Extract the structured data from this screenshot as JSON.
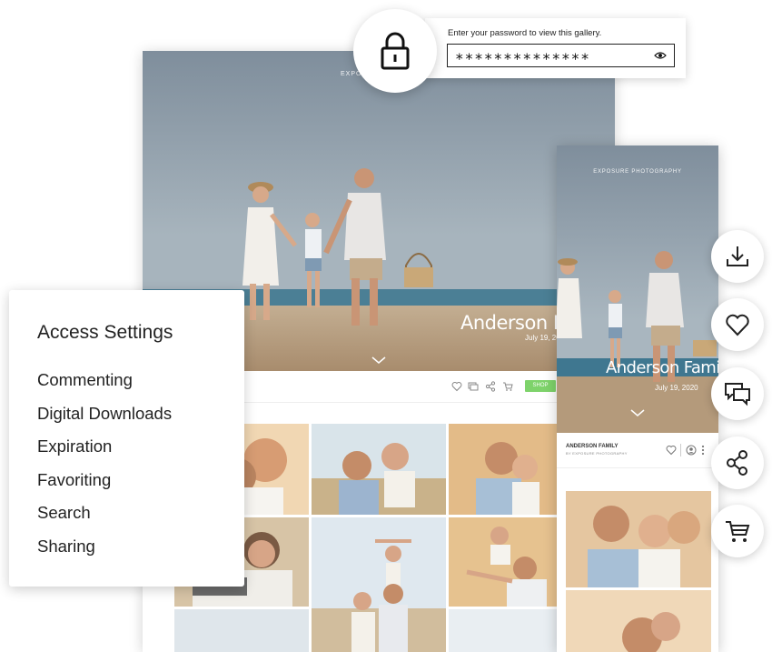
{
  "password_prompt": {
    "label": "Enter your password to view this gallery.",
    "value": "**************",
    "lock_icon": "lock-icon",
    "reveal_icon": "eye-icon"
  },
  "desktop_gallery": {
    "brand": "EXPOSURE PHOTOGRAPHY",
    "hero_title": "Anderson Family",
    "hero_date": "July 19, 2020",
    "shop_label": "SHOP",
    "toolbar_icons": [
      "heart-icon",
      "comment-icon",
      "share-icon",
      "cart-icon"
    ]
  },
  "phone_gallery": {
    "brand": "EXPOSURE PHOTOGRAPHY",
    "hero_title": "Anderson Family",
    "hero_date": "July 19, 2020",
    "gallery_title": "ANDERSON FAMILY",
    "gallery_subtitle": "BY EXPOSURE PHOTOGRAPHY"
  },
  "access_settings": {
    "title": "Access Settings",
    "items": [
      "Commenting",
      "Digital Downloads",
      "Expiration",
      "Favoriting",
      "Search",
      "Sharing"
    ]
  },
  "actions": [
    "download-icon",
    "heart-icon",
    "comments-icon",
    "share-icon",
    "cart-icon"
  ]
}
